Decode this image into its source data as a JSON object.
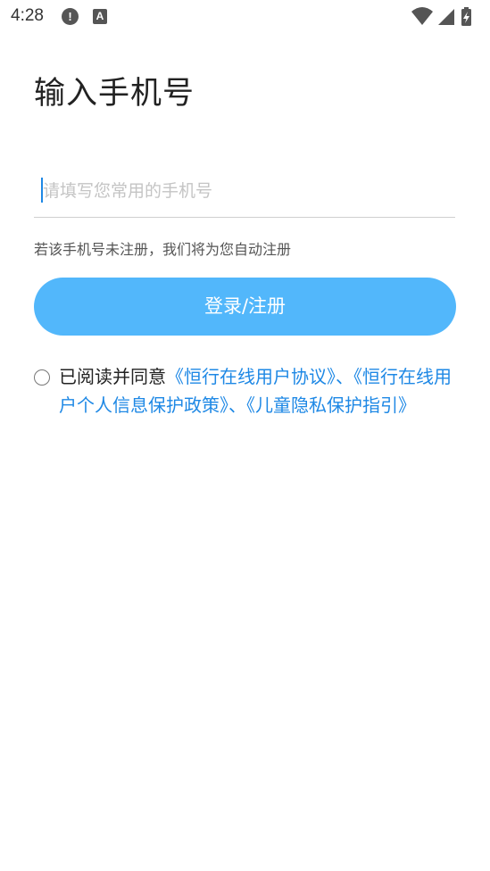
{
  "status_bar": {
    "time": "4:28",
    "alert_icon_glyph": "!",
    "a_icon_glyph": "A"
  },
  "login": {
    "title": "输入手机号",
    "phone_input": {
      "value": "",
      "placeholder": "请填写您常用的手机号"
    },
    "hint": "若该手机号未注册，我们将为您自动注册",
    "submit_label": "登录/注册"
  },
  "agreement": {
    "checked": false,
    "prefix": "已阅读并同意",
    "link_user_agreement": "《恒行在线用户协议》",
    "separator_1": "、",
    "link_privacy_policy": "《恒行在线用户个人信息保护政策》",
    "separator_2": "、",
    "link_child_privacy": "《儿童隐私保护指引》"
  },
  "colors": {
    "accent": "#52b7fb",
    "link": "#1e88e5",
    "cursor": "#1e88e5"
  }
}
